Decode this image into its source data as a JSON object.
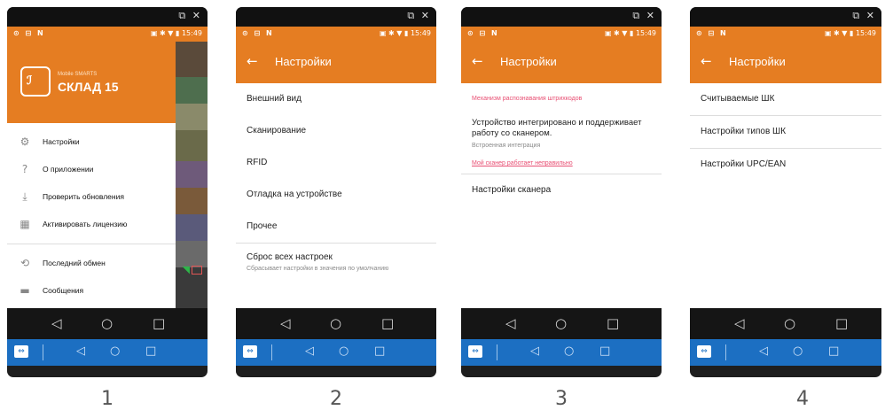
{
  "window_controls": "⧉ ✕",
  "status": {
    "left": "⊙ ⊟ N",
    "right": "▣ ✱ ▼ ▮ 15:49"
  },
  "phone1": {
    "brand_small": "Mobile SMARTS",
    "brand_big": "СКЛАД 15",
    "menu": [
      {
        "label": "Настройки",
        "icon": "gear-icon"
      },
      {
        "label": "О приложении",
        "icon": "help-icon"
      },
      {
        "label": "Проверить обновления",
        "icon": "download-icon"
      },
      {
        "label": "Активировать лицензию",
        "icon": "license-icon"
      },
      {
        "label": "Последний обмен",
        "icon": "sync-icon"
      },
      {
        "label": "Сообщения",
        "icon": "message-icon"
      }
    ]
  },
  "phone2": {
    "title": "Настройки",
    "items": [
      "Внешний вид",
      "Сканирование",
      "RFID",
      "Отладка на устройстве",
      "Прочее"
    ],
    "reset_title": "Сброс всех настроек",
    "reset_sub": "Сбрасывает настройки в значения по умолчанию"
  },
  "phone3": {
    "title": "Настройки",
    "section": "Механизм распознавания штрихкодов",
    "device_text": "Устройство интегрировано и поддерживает работу со сканером.",
    "device_sub": "Встроенная интеграция",
    "link": "Мой сканер работает неправильно",
    "scanner_settings": "Настройки сканера"
  },
  "phone4": {
    "title": "Настройки",
    "items": [
      "Считываемые ШК",
      "Настройки типов ШК",
      "Настройки UPC/EAN"
    ]
  },
  "captions": [
    "1",
    "2",
    "3",
    "4"
  ],
  "colors": {
    "accent": "#e57d22",
    "blue": "#1c6fc2",
    "link": "#e84f73"
  }
}
